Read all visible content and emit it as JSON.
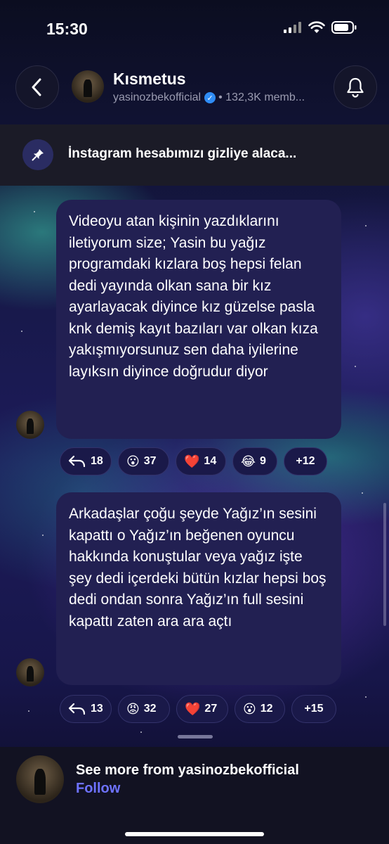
{
  "status_bar": {
    "time": "15:30"
  },
  "header": {
    "title": "Kısmetus",
    "owner": "yasinozbekofficial",
    "members": "• 132,3K memb..."
  },
  "pinned": {
    "text": "İnstagram hesabımızı gizliye alaca..."
  },
  "messages": [
    {
      "text": "Videoyu atan kişinin yazdıklarını iletiyorum size; Yasin bu yağız programdaki kızlara boş hepsi felan dedi yayında olkan sana bir kız ayarlayacak diyince kız güzelse pasla knk demiş kayıt bazıları var olkan kıza yakışmıyorsunuz sen daha iyilerine layıksın diyince doğrudur diyor",
      "reactions": [
        {
          "emoji": "↩",
          "icon": "reply-icon",
          "count": "18"
        },
        {
          "emoji": "😮",
          "icon": "surprised-emoji",
          "count": "37"
        },
        {
          "emoji": "❤️",
          "icon": "heart-emoji",
          "count": "14"
        },
        {
          "emoji": "😂",
          "icon": "laughing-emoji",
          "count": "9"
        },
        {
          "emoji": "",
          "icon": "",
          "count": "+12"
        }
      ]
    },
    {
      "text": "Arkadaşlar çoğu şeyde Yağız’ın sesini kapattı o Yağız’ın beğenen oyuncu hakkında konuştular veya yağız işte şey dedi içerdeki bütün kızlar hepsi boş dedi ondan sonra Yağız’ın full sesini kapattı zaten ara ara açtı",
      "reactions": [
        {
          "emoji": "↩",
          "icon": "reply-icon",
          "count": "13"
        },
        {
          "emoji": "😡",
          "icon": "angry-emoji",
          "count": "32"
        },
        {
          "emoji": "❤️",
          "icon": "heart-emoji",
          "count": "27"
        },
        {
          "emoji": "😮",
          "icon": "surprised-emoji",
          "count": "12"
        },
        {
          "emoji": "",
          "icon": "",
          "count": "+15"
        }
      ]
    }
  ],
  "footer": {
    "title": "See more from yasinozbekofficial",
    "follow_label": "Follow"
  }
}
